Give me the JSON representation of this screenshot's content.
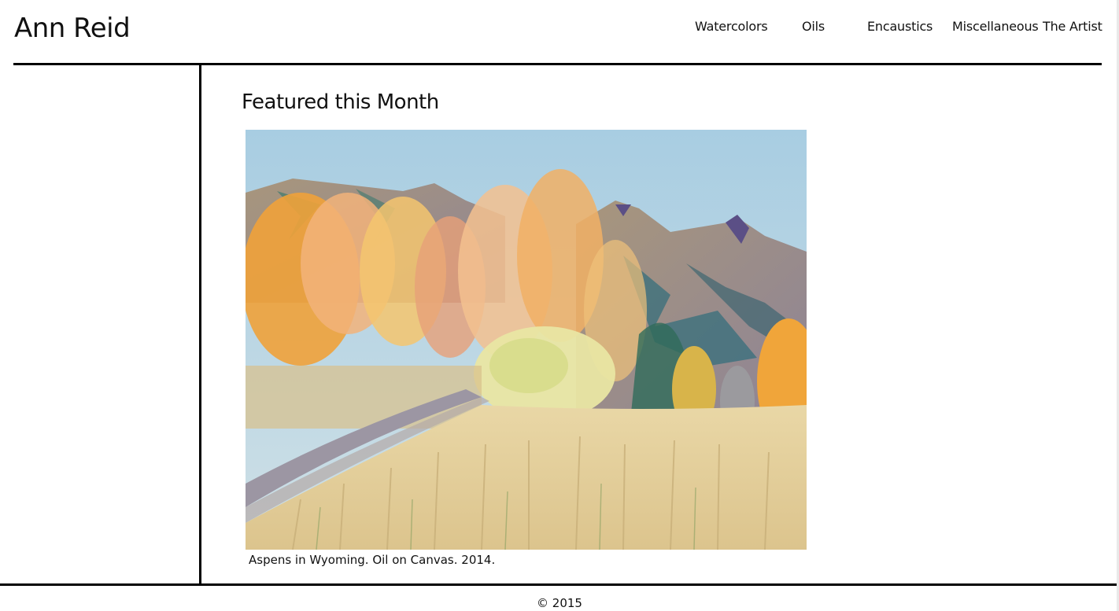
{
  "site": {
    "title": "Ann Reid"
  },
  "nav": {
    "items": [
      {
        "label": "Watercolors"
      },
      {
        "label": "Oils"
      },
      {
        "label": "Encaustics"
      },
      {
        "label": "Miscellaneous"
      },
      {
        "label": "The Artist"
      }
    ]
  },
  "main": {
    "heading": "Featured this Month",
    "featured_image_alt": "Aspens in Wyoming painting",
    "caption": "Aspens in Wyoming. Oil on Canvas. 2014."
  },
  "footer": {
    "copyright": "© 2015"
  },
  "colors": {
    "rules": "#000000",
    "text": "#111111",
    "background": "#ffffff"
  }
}
